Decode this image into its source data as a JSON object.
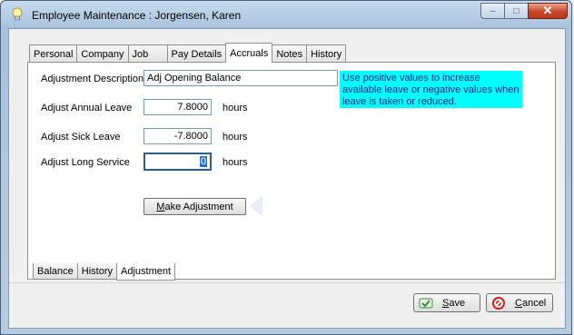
{
  "window": {
    "title": "Employee Maintenance : Jorgensen, Karen",
    "minimize": "–",
    "maximize": "□",
    "close": "✕",
    "title_icon": "lightbulb-icon"
  },
  "tabs": [
    {
      "label": "Personal",
      "active": false
    },
    {
      "label": "Company",
      "active": false
    },
    {
      "label": "Job",
      "active": false
    },
    {
      "label": "Pay Details",
      "active": false
    },
    {
      "label": "Accruals",
      "active": true
    },
    {
      "label": "Notes",
      "active": false
    },
    {
      "label": "History",
      "active": false
    }
  ],
  "form": {
    "adjustment_description_label": "Adjustment Description",
    "adjustment_description_value": "Adj Opening Balance",
    "annual_leave_label": "Adjust Annual Leave",
    "annual_leave_value": "7.8000",
    "sick_leave_label": "Adjust Sick Leave",
    "sick_leave_value": "-7.8000",
    "long_service_label": "Adjust Long Service",
    "long_service_value": "0",
    "unit": "hours",
    "info_text": "Use positive values to increase available leave or negative values when leave is taken or reduced.",
    "make_adjustment_accel": "M",
    "make_adjustment_rest": "ake Adjustment"
  },
  "bottom_tabs": [
    {
      "label": "Balance",
      "active": false
    },
    {
      "label": "History",
      "active": false
    },
    {
      "label": "Adjustment",
      "active": true
    }
  ],
  "buttons": {
    "save_accel": "S",
    "save_rest": "ave",
    "cancel_accel": "C",
    "cancel_rest": "ancel"
  },
  "colors": {
    "info_bg": "#00ffff",
    "info_text": "#002a88",
    "save_icon": "#3d8a3f",
    "cancel_icon": "#cc1f1f"
  }
}
